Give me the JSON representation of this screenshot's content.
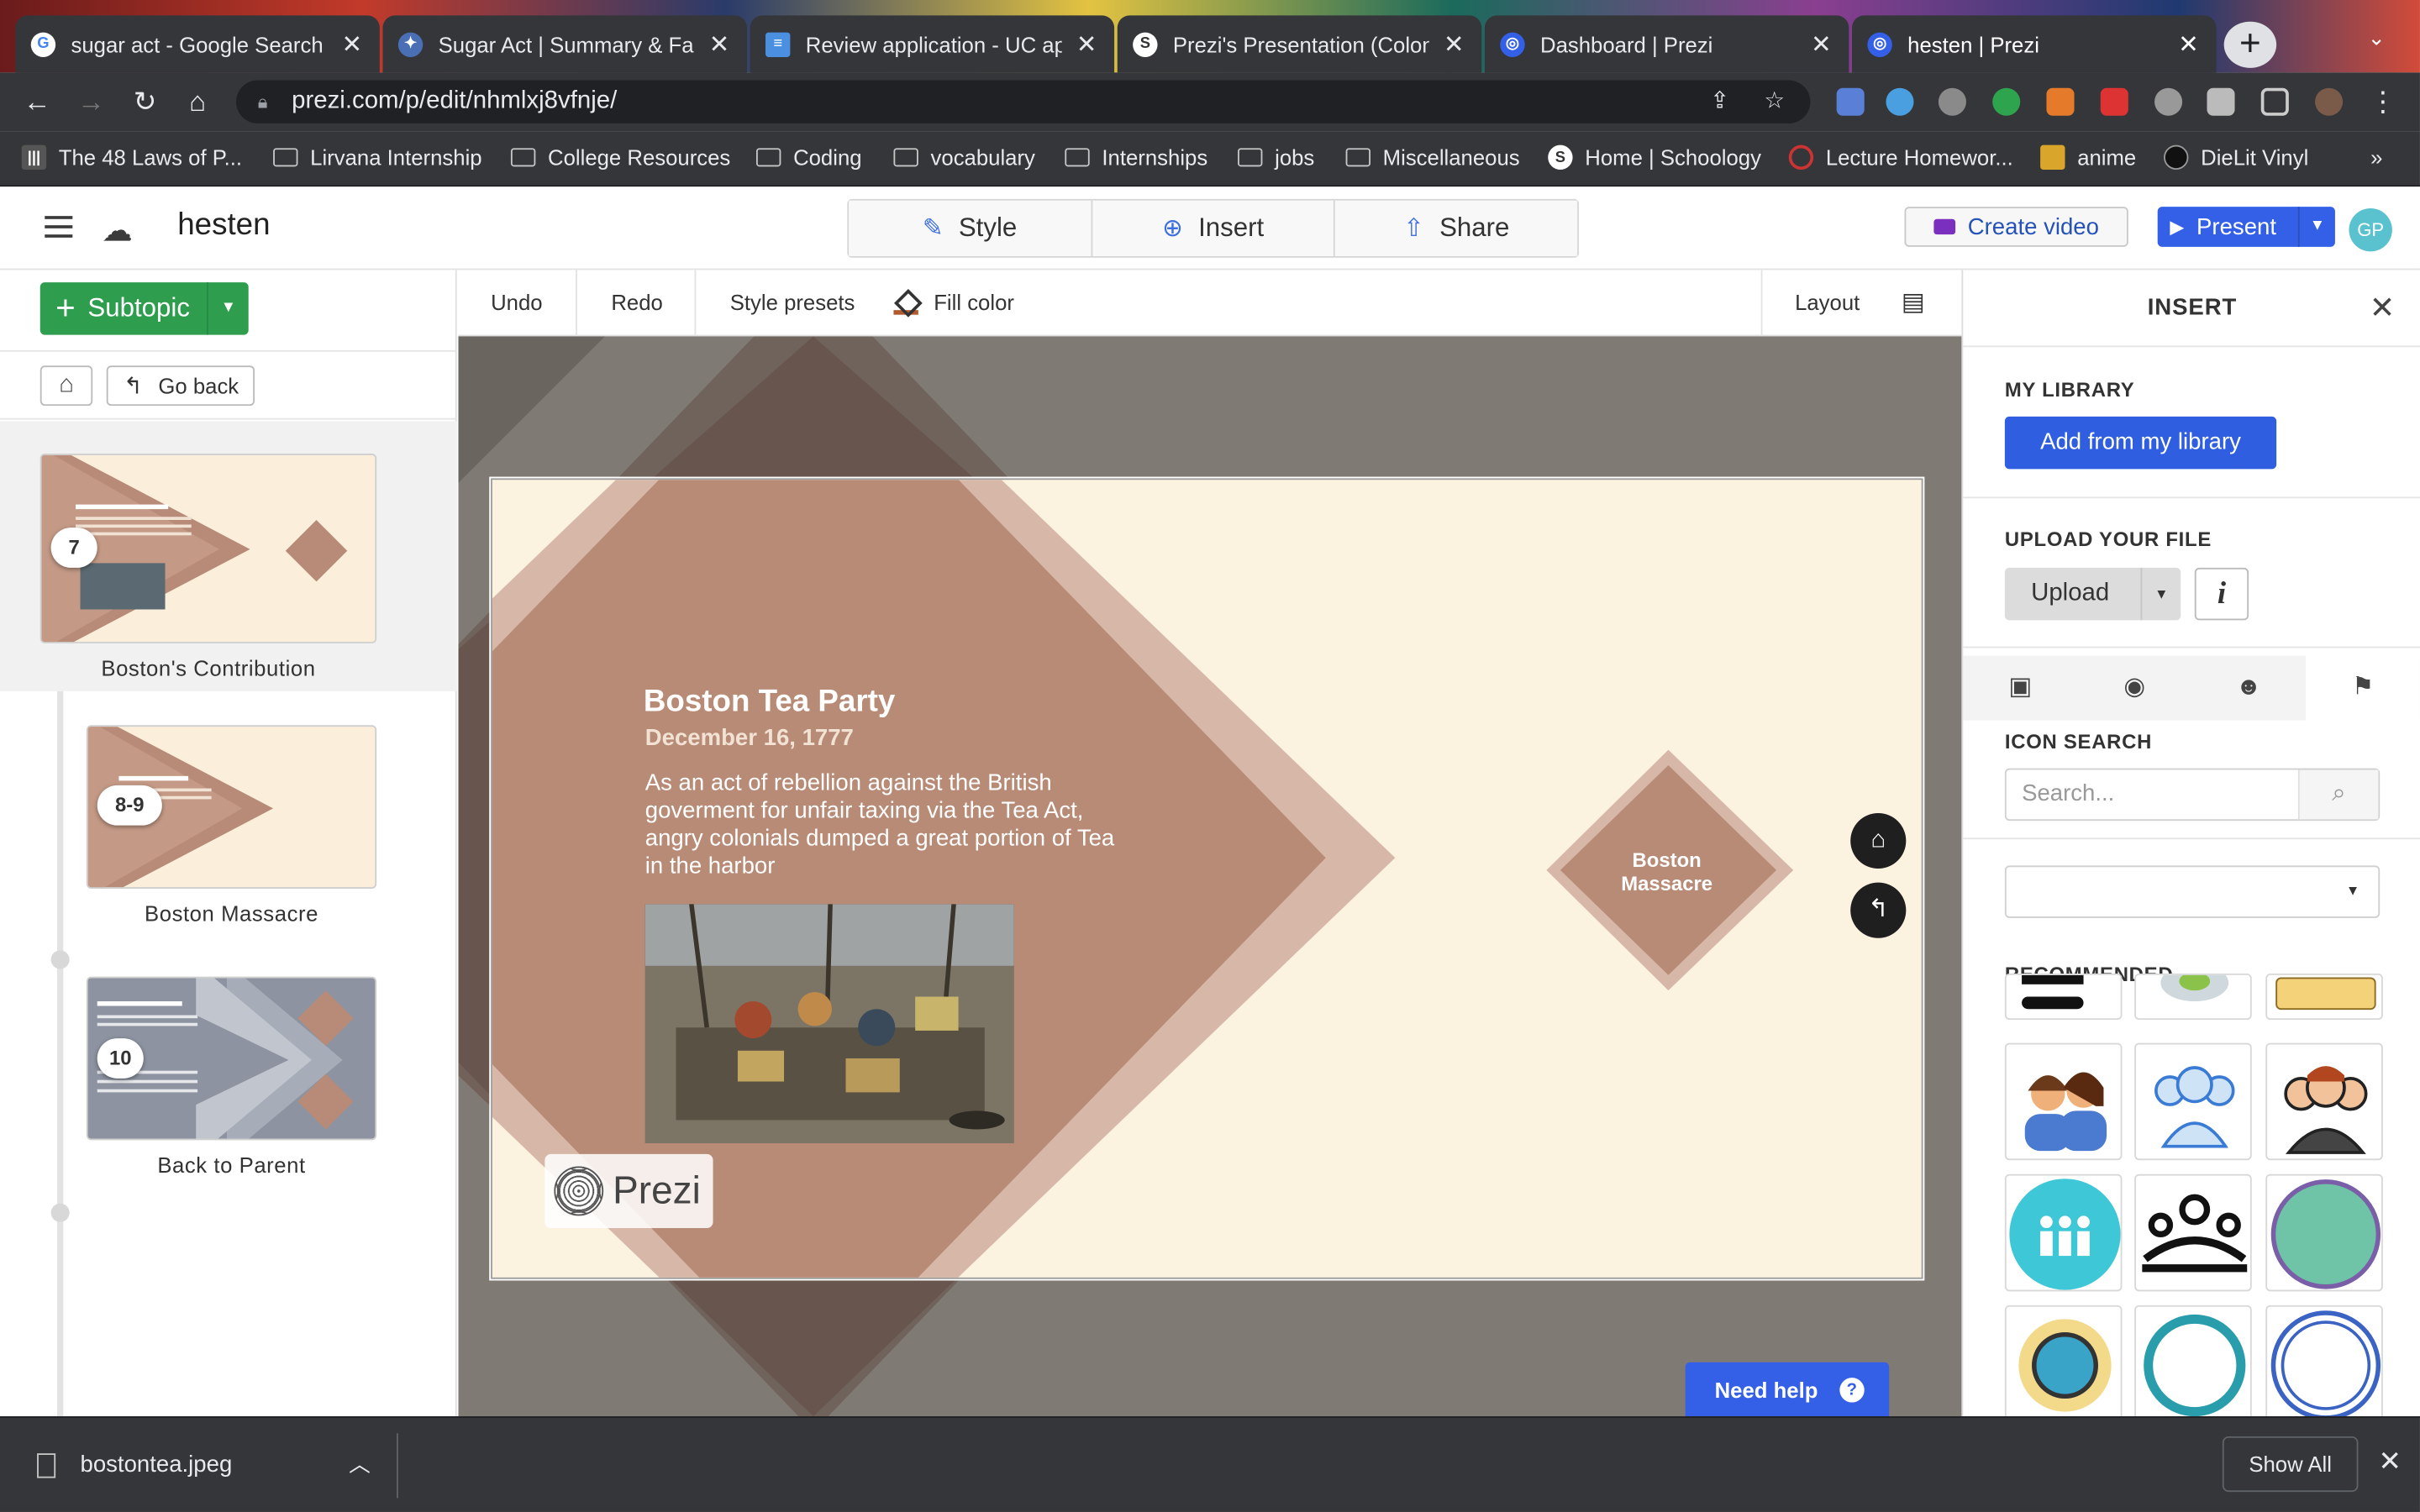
{
  "browser": {
    "tabs": [
      {
        "title": "sugar act - Google Search",
        "favicon": "google-icon"
      },
      {
        "title": "Sugar Act | Summary & Fac",
        "favicon": "britannica-icon"
      },
      {
        "title": "Review application - UC ap",
        "favicon": "uc-apply-icon"
      },
      {
        "title": "Prezi's Presentation (Colon",
        "favicon": "schoology-icon"
      },
      {
        "title": "Dashboard | Prezi",
        "favicon": "prezi-icon"
      },
      {
        "title": "hesten | Prezi",
        "favicon": "prezi-icon",
        "active": true
      }
    ],
    "url": "prezi.com/p/edit/nhmlxj8vfnje/",
    "bookmarks": [
      "The 48 Laws of P...",
      "Lirvana Internship",
      "College Resources",
      "Coding",
      "vocabulary",
      "Internships",
      "jobs",
      "Miscellaneous",
      "Home | Schoology",
      "Lecture Homewor...",
      "anime",
      "DieLit Vinyl"
    ]
  },
  "prezi": {
    "title": "hesten",
    "menu": {
      "style": "Style",
      "insert": "Insert",
      "share": "Share"
    },
    "create_video": "Create video",
    "present": "Present",
    "avatar": "GP",
    "accent": "#3460e7"
  },
  "sidebar": {
    "subtopic": "Subtopic",
    "go_back": "Go back",
    "items": [
      {
        "badge": "7",
        "label": "Boston's Contribution"
      },
      {
        "badge": "8-9",
        "label": "Boston Massacre"
      },
      {
        "badge": "10",
        "label": "Back to Parent"
      }
    ]
  },
  "toolbar": {
    "undo": "Undo",
    "redo": "Redo",
    "style_presets": "Style presets",
    "fill_color": "Fill color",
    "layout": "Layout"
  },
  "slide": {
    "title": "Boston Tea Party",
    "date": "December 16, 1777",
    "body": "As an act of rebellion against the British goverment for unfair taxing via the Tea Act, angry colonials dumped a great portion of Tea in the harbor",
    "topic_label": "Boston Massacre",
    "logo": "Prezi"
  },
  "need_help": "Need help",
  "insert_panel": {
    "title": "INSERT",
    "my_library": "MY LIBRARY",
    "add_from_library": "Add from my library",
    "upload_your_file": "UPLOAD YOUR FILE",
    "upload": "Upload",
    "icon_search": "ICON SEARCH",
    "search_placeholder": "Search...",
    "recommended": "RECOMMENDED"
  },
  "downloads": {
    "file": "bostontea.jpeg",
    "show_all": "Show All"
  }
}
